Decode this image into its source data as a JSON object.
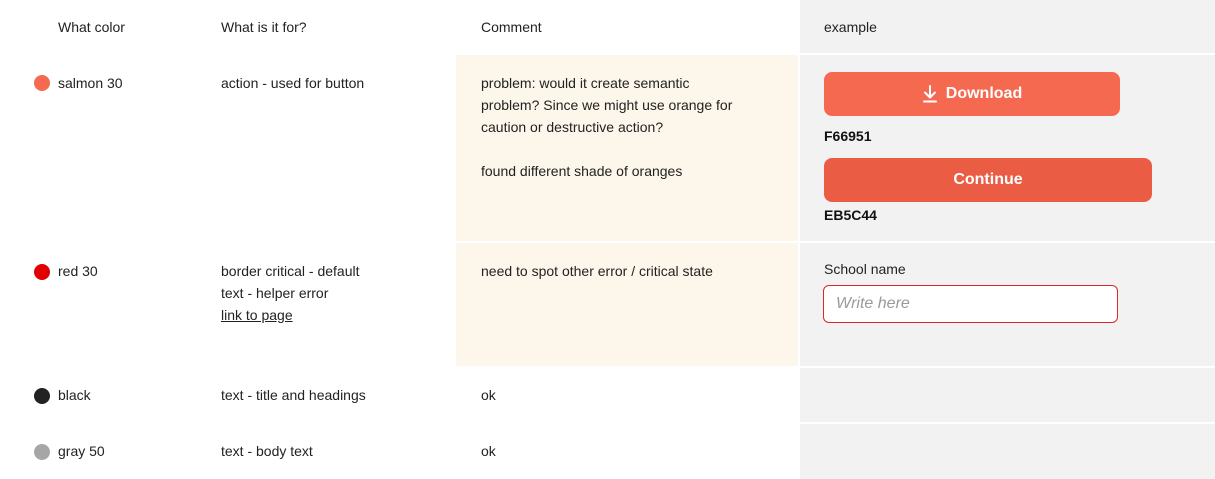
{
  "headers": {
    "color": "What color",
    "purpose": "What is it for?",
    "comment": "Comment",
    "example": "example"
  },
  "rows": [
    {
      "color_name": "salmon 30",
      "dot_color": "#F66951",
      "purpose": [
        "action - used for button"
      ],
      "comment": [
        "problem: would it create semantic",
        "problem? Since we might use orange for",
        "caution or destructive action?",
        "",
        "found different shade of oranges"
      ]
    },
    {
      "color_name": "red 30",
      "dot_color": "#E00000",
      "purpose": [
        "border critical - default",
        "text - helper error"
      ],
      "purpose_link": "link to page",
      "comment": [
        "need to spot other error / critical state"
      ]
    },
    {
      "color_name": "black",
      "dot_color": "#222222",
      "purpose": [
        "text - title and headings"
      ],
      "comment": [
        "ok"
      ]
    },
    {
      "color_name": "gray 50",
      "dot_color": "#A6A6A6",
      "purpose": [
        "text - body text"
      ],
      "comment": [
        "ok"
      ]
    }
  ],
  "examples": {
    "download_button": {
      "label": "Download",
      "color": "#F66951",
      "icon": "download-icon"
    },
    "download_hex": "F66951",
    "continue_button": {
      "label": "Continue",
      "color": "#EB5C44"
    },
    "continue_hex": "EB5C44",
    "school_field": {
      "label": "School name",
      "placeholder": "Write here",
      "border_color": "#E0242A"
    }
  },
  "colors": {
    "comment_bg": "#FDF6EA",
    "example_bg": "#F2F2F2"
  }
}
